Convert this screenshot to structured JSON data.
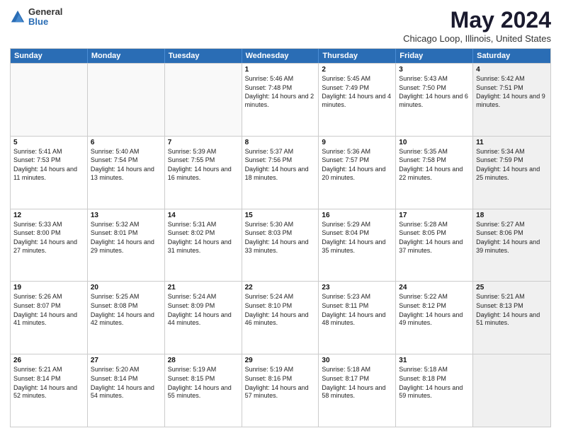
{
  "logo": {
    "general": "General",
    "blue": "Blue"
  },
  "header": {
    "title": "May 2024",
    "subtitle": "Chicago Loop, Illinois, United States"
  },
  "days": [
    "Sunday",
    "Monday",
    "Tuesday",
    "Wednesday",
    "Thursday",
    "Friday",
    "Saturday"
  ],
  "weeks": [
    [
      {
        "day": "",
        "sunrise": "",
        "sunset": "",
        "daylight": "",
        "empty": true
      },
      {
        "day": "",
        "sunrise": "",
        "sunset": "",
        "daylight": "",
        "empty": true
      },
      {
        "day": "",
        "sunrise": "",
        "sunset": "",
        "daylight": "",
        "empty": true
      },
      {
        "day": "1",
        "sunrise": "Sunrise: 5:46 AM",
        "sunset": "Sunset: 7:48 PM",
        "daylight": "Daylight: 14 hours and 2 minutes."
      },
      {
        "day": "2",
        "sunrise": "Sunrise: 5:45 AM",
        "sunset": "Sunset: 7:49 PM",
        "daylight": "Daylight: 14 hours and 4 minutes."
      },
      {
        "day": "3",
        "sunrise": "Sunrise: 5:43 AM",
        "sunset": "Sunset: 7:50 PM",
        "daylight": "Daylight: 14 hours and 6 minutes."
      },
      {
        "day": "4",
        "sunrise": "Sunrise: 5:42 AM",
        "sunset": "Sunset: 7:51 PM",
        "daylight": "Daylight: 14 hours and 9 minutes.",
        "shaded": true
      }
    ],
    [
      {
        "day": "5",
        "sunrise": "Sunrise: 5:41 AM",
        "sunset": "Sunset: 7:53 PM",
        "daylight": "Daylight: 14 hours and 11 minutes."
      },
      {
        "day": "6",
        "sunrise": "Sunrise: 5:40 AM",
        "sunset": "Sunset: 7:54 PM",
        "daylight": "Daylight: 14 hours and 13 minutes."
      },
      {
        "day": "7",
        "sunrise": "Sunrise: 5:39 AM",
        "sunset": "Sunset: 7:55 PM",
        "daylight": "Daylight: 14 hours and 16 minutes."
      },
      {
        "day": "8",
        "sunrise": "Sunrise: 5:37 AM",
        "sunset": "Sunset: 7:56 PM",
        "daylight": "Daylight: 14 hours and 18 minutes."
      },
      {
        "day": "9",
        "sunrise": "Sunrise: 5:36 AM",
        "sunset": "Sunset: 7:57 PM",
        "daylight": "Daylight: 14 hours and 20 minutes."
      },
      {
        "day": "10",
        "sunrise": "Sunrise: 5:35 AM",
        "sunset": "Sunset: 7:58 PM",
        "daylight": "Daylight: 14 hours and 22 minutes."
      },
      {
        "day": "11",
        "sunrise": "Sunrise: 5:34 AM",
        "sunset": "Sunset: 7:59 PM",
        "daylight": "Daylight: 14 hours and 25 minutes.",
        "shaded": true
      }
    ],
    [
      {
        "day": "12",
        "sunrise": "Sunrise: 5:33 AM",
        "sunset": "Sunset: 8:00 PM",
        "daylight": "Daylight: 14 hours and 27 minutes."
      },
      {
        "day": "13",
        "sunrise": "Sunrise: 5:32 AM",
        "sunset": "Sunset: 8:01 PM",
        "daylight": "Daylight: 14 hours and 29 minutes."
      },
      {
        "day": "14",
        "sunrise": "Sunrise: 5:31 AM",
        "sunset": "Sunset: 8:02 PM",
        "daylight": "Daylight: 14 hours and 31 minutes."
      },
      {
        "day": "15",
        "sunrise": "Sunrise: 5:30 AM",
        "sunset": "Sunset: 8:03 PM",
        "daylight": "Daylight: 14 hours and 33 minutes."
      },
      {
        "day": "16",
        "sunrise": "Sunrise: 5:29 AM",
        "sunset": "Sunset: 8:04 PM",
        "daylight": "Daylight: 14 hours and 35 minutes."
      },
      {
        "day": "17",
        "sunrise": "Sunrise: 5:28 AM",
        "sunset": "Sunset: 8:05 PM",
        "daylight": "Daylight: 14 hours and 37 minutes."
      },
      {
        "day": "18",
        "sunrise": "Sunrise: 5:27 AM",
        "sunset": "Sunset: 8:06 PM",
        "daylight": "Daylight: 14 hours and 39 minutes.",
        "shaded": true
      }
    ],
    [
      {
        "day": "19",
        "sunrise": "Sunrise: 5:26 AM",
        "sunset": "Sunset: 8:07 PM",
        "daylight": "Daylight: 14 hours and 41 minutes."
      },
      {
        "day": "20",
        "sunrise": "Sunrise: 5:25 AM",
        "sunset": "Sunset: 8:08 PM",
        "daylight": "Daylight: 14 hours and 42 minutes."
      },
      {
        "day": "21",
        "sunrise": "Sunrise: 5:24 AM",
        "sunset": "Sunset: 8:09 PM",
        "daylight": "Daylight: 14 hours and 44 minutes."
      },
      {
        "day": "22",
        "sunrise": "Sunrise: 5:24 AM",
        "sunset": "Sunset: 8:10 PM",
        "daylight": "Daylight: 14 hours and 46 minutes."
      },
      {
        "day": "23",
        "sunrise": "Sunrise: 5:23 AM",
        "sunset": "Sunset: 8:11 PM",
        "daylight": "Daylight: 14 hours and 48 minutes."
      },
      {
        "day": "24",
        "sunrise": "Sunrise: 5:22 AM",
        "sunset": "Sunset: 8:12 PM",
        "daylight": "Daylight: 14 hours and 49 minutes."
      },
      {
        "day": "25",
        "sunrise": "Sunrise: 5:21 AM",
        "sunset": "Sunset: 8:13 PM",
        "daylight": "Daylight: 14 hours and 51 minutes.",
        "shaded": true
      }
    ],
    [
      {
        "day": "26",
        "sunrise": "Sunrise: 5:21 AM",
        "sunset": "Sunset: 8:14 PM",
        "daylight": "Daylight: 14 hours and 52 minutes."
      },
      {
        "day": "27",
        "sunrise": "Sunrise: 5:20 AM",
        "sunset": "Sunset: 8:14 PM",
        "daylight": "Daylight: 14 hours and 54 minutes."
      },
      {
        "day": "28",
        "sunrise": "Sunrise: 5:19 AM",
        "sunset": "Sunset: 8:15 PM",
        "daylight": "Daylight: 14 hours and 55 minutes."
      },
      {
        "day": "29",
        "sunrise": "Sunrise: 5:19 AM",
        "sunset": "Sunset: 8:16 PM",
        "daylight": "Daylight: 14 hours and 57 minutes."
      },
      {
        "day": "30",
        "sunrise": "Sunrise: 5:18 AM",
        "sunset": "Sunset: 8:17 PM",
        "daylight": "Daylight: 14 hours and 58 minutes."
      },
      {
        "day": "31",
        "sunrise": "Sunrise: 5:18 AM",
        "sunset": "Sunset: 8:18 PM",
        "daylight": "Daylight: 14 hours and 59 minutes."
      },
      {
        "day": "",
        "sunrise": "",
        "sunset": "",
        "daylight": "",
        "empty": true,
        "shaded": true
      }
    ]
  ]
}
